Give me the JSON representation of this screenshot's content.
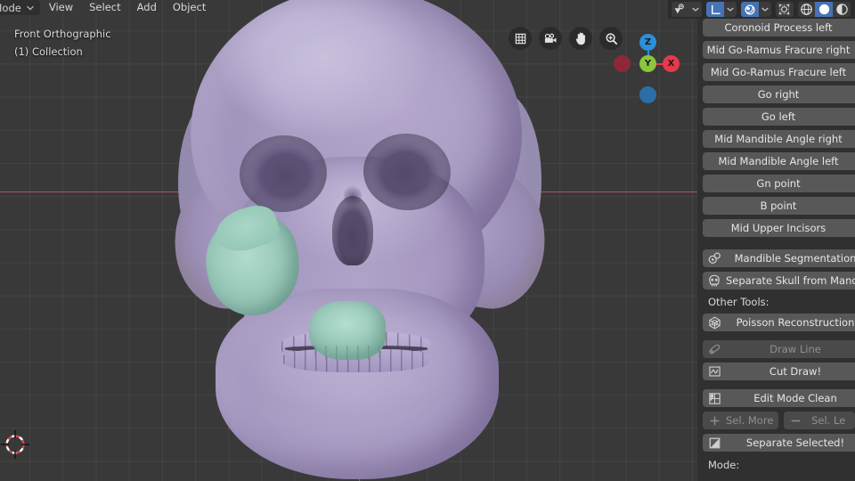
{
  "app": {
    "mode_selector": "ct Mode",
    "menus": [
      "View",
      "Select",
      "Add",
      "Object"
    ]
  },
  "viewport": {
    "view_name": "Front Orthographic",
    "collection": "(1) Collection",
    "gizmo_axes": [
      {
        "label": "Z",
        "color": "#2c8fd8"
      },
      {
        "label": "Y",
        "color": "#8cc63e"
      },
      {
        "label": "X",
        "color": "#e8394a"
      }
    ],
    "overlay_buttons": [
      {
        "name": "toggle-xray-icon",
        "label": "grid"
      },
      {
        "name": "camera-view-icon",
        "label": "camera"
      },
      {
        "name": "pan-view-icon",
        "label": "hand"
      },
      {
        "name": "zoom-view-icon",
        "label": "magnifier"
      }
    ],
    "axis_x_color": "#a8545f",
    "axis_z_color": "#3b7fa6",
    "mesh_color": "#a99cc3",
    "selection_color": "#9ccbbc"
  },
  "header_strip": {
    "groups": [
      {
        "buttons": [
          {
            "name": "visibility-icon",
            "state": "off",
            "caret": true
          }
        ]
      },
      {
        "buttons": [
          {
            "name": "transform-orientation-icon",
            "state": "on",
            "caret": true
          }
        ]
      },
      {
        "buttons": [
          {
            "name": "snap-magnet-icon",
            "state": "on",
            "caret": true
          }
        ]
      },
      {
        "buttons": [
          {
            "name": "proportional-edit-icon",
            "state": "off",
            "caret": false
          }
        ]
      },
      {
        "buttons": [
          {
            "name": "shading-wireframe-icon",
            "state": "off",
            "caret": false
          },
          {
            "name": "shading-solid-icon",
            "state": "on",
            "caret": false
          },
          {
            "name": "shading-material-icon",
            "state": "off",
            "caret": false
          }
        ]
      }
    ]
  },
  "sidebar": {
    "landmark_buttons": [
      "Coronoid Process left",
      "Mid Go-Ramus Fracure right",
      "Mid Go-Ramus Fracure left",
      "Go right",
      "Go left",
      "Mid Mandible Angle right",
      "Mid Mandible Angle left",
      "Gn point",
      "B point",
      "Mid Upper Incisors"
    ],
    "segmentation_buttons": [
      {
        "label": "Mandible Segmentation",
        "icon": "target-circles-icon",
        "enabled": true
      },
      {
        "label": "Separate Skull from Mandible",
        "icon": "skull-icon",
        "enabled": true
      }
    ],
    "other_tools_label": "Other Tools:",
    "other_tools": [
      {
        "label": "Poisson Reconstruction",
        "icon": "mesh-icosphere-icon",
        "enabled": true
      },
      {
        "label": "Draw Line",
        "icon": "annotate-pen-icon",
        "enabled": false
      },
      {
        "label": "Cut Draw!",
        "icon": "graph-curve-icon",
        "enabled": true
      },
      {
        "label": "Edit Mode Clean",
        "icon": "uv-grid-icon",
        "enabled": true
      }
    ],
    "select_pair": [
      {
        "label": "Sel. More",
        "icon": "plus-icon",
        "enabled": false
      },
      {
        "label": "Sel. Le",
        "icon": "minus-icon",
        "enabled": false
      }
    ],
    "separate_button": {
      "label": "Separate Selected!",
      "icon": "separate-icon",
      "enabled": true
    },
    "mode_label": "Mode:"
  }
}
